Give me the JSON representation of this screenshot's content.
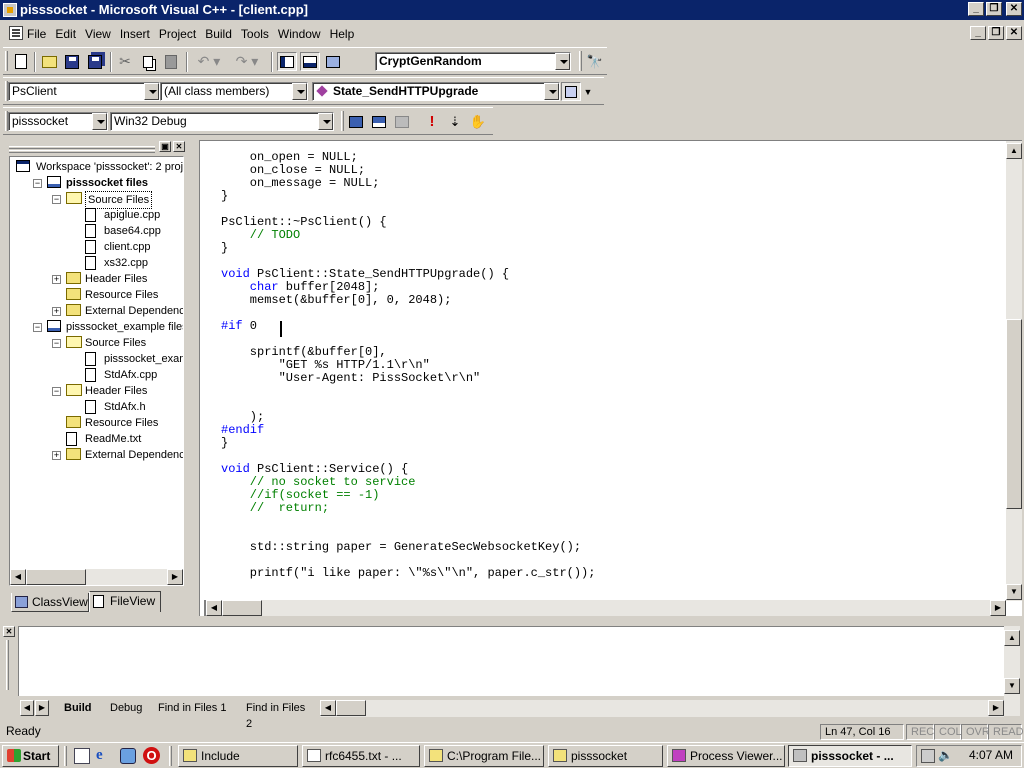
{
  "window": {
    "title": "pisssocket - Microsoft Visual C++ - [client.cpp]"
  },
  "menu": [
    "File",
    "Edit",
    "View",
    "Insert",
    "Project",
    "Build",
    "Tools",
    "Window",
    "Help"
  ],
  "toolbar": {
    "find_combo": "CryptGenRandom"
  },
  "wizardbar": {
    "class": "PsClient",
    "filter": "(All class members)",
    "member": "State_SendHTTPUpgrade"
  },
  "buildbar": {
    "project": "pisssocket",
    "config": "Win32 Debug"
  },
  "workspace": {
    "tree": [
      {
        "label": "Workspace 'pisssocket': 2 proje",
        "depth": 0,
        "icon": "workspace",
        "toggle": ""
      },
      {
        "label": "pisssocket files",
        "depth": 1,
        "icon": "project",
        "toggle": "−",
        "bold": true
      },
      {
        "label": "Source Files",
        "depth": 2,
        "icon": "folder-open",
        "toggle": "−",
        "selected": true
      },
      {
        "label": "apiglue.cpp",
        "depth": 3,
        "icon": "file-cpp",
        "toggle": ""
      },
      {
        "label": "base64.cpp",
        "depth": 3,
        "icon": "file-cpp",
        "toggle": ""
      },
      {
        "label": "client.cpp",
        "depth": 3,
        "icon": "file-cpp",
        "toggle": ""
      },
      {
        "label": "xs32.cpp",
        "depth": 3,
        "icon": "file-cpp",
        "toggle": ""
      },
      {
        "label": "Header Files",
        "depth": 2,
        "icon": "folder",
        "toggle": "+"
      },
      {
        "label": "Resource Files",
        "depth": 2,
        "icon": "folder",
        "toggle": ""
      },
      {
        "label": "External Dependencies",
        "depth": 2,
        "icon": "folder",
        "toggle": "+"
      },
      {
        "label": "pisssocket_example files",
        "depth": 1,
        "icon": "project",
        "toggle": "−"
      },
      {
        "label": "Source Files",
        "depth": 2,
        "icon": "folder-open",
        "toggle": "−"
      },
      {
        "label": "pisssocket_exampl",
        "depth": 3,
        "icon": "file-cpp",
        "toggle": ""
      },
      {
        "label": "StdAfx.cpp",
        "depth": 3,
        "icon": "file-cpp",
        "toggle": ""
      },
      {
        "label": "Header Files",
        "depth": 2,
        "icon": "folder-open",
        "toggle": "−"
      },
      {
        "label": "StdAfx.h",
        "depth": 3,
        "icon": "file-h",
        "toggle": ""
      },
      {
        "label": "Resource Files",
        "depth": 2,
        "icon": "folder",
        "toggle": ""
      },
      {
        "label": "ReadMe.txt",
        "depth": 2,
        "icon": "file-txt",
        "toggle": ""
      },
      {
        "label": "External Dependencies",
        "depth": 2,
        "icon": "folder",
        "toggle": "+"
      }
    ],
    "tabs": [
      "ClassView",
      "FileView"
    ]
  },
  "editor": {
    "lines": [
      [
        [
          "",
          "    on_open = NULL;"
        ]
      ],
      [
        [
          "",
          "    on_close = NULL;"
        ]
      ],
      [
        [
          "",
          "    on_message = NULL;"
        ]
      ],
      [
        [
          "",
          "}"
        ]
      ],
      [
        [
          "",
          ""
        ]
      ],
      [
        [
          "",
          "PsClient::~PsClient() {"
        ]
      ],
      [
        [
          "cm",
          "    // TODO"
        ]
      ],
      [
        [
          "",
          "}"
        ]
      ],
      [
        [
          "",
          ""
        ]
      ],
      [
        [
          "kw",
          "void"
        ],
        [
          "",
          " PsClient::State_SendHTTPUpgrade() {"
        ]
      ],
      [
        [
          "kw",
          "    char"
        ],
        [
          "",
          " buffer[2048];"
        ]
      ],
      [
        [
          "",
          "    memset(&buffer[0], 0, 2048);"
        ]
      ],
      [
        [
          "",
          ""
        ]
      ],
      [
        [
          "kw",
          "#if"
        ],
        [
          "",
          " 0"
        ]
      ],
      [
        [
          "",
          ""
        ]
      ],
      [
        [
          "",
          "    sprintf(&buffer[0],"
        ]
      ],
      [
        [
          "",
          "        \"GET %s HTTP/1.1\\r\\n\""
        ]
      ],
      [
        [
          "",
          "        \"User-Agent: PissSocket\\r\\n\""
        ]
      ],
      [
        [
          "",
          ""
        ]
      ],
      [
        [
          "",
          ""
        ]
      ],
      [
        [
          "",
          "    );"
        ]
      ],
      [
        [
          "kw",
          "#endif"
        ]
      ],
      [
        [
          "",
          "}"
        ]
      ],
      [
        [
          "",
          ""
        ]
      ],
      [
        [
          "kw",
          "void"
        ],
        [
          "",
          " PsClient::Service() {"
        ]
      ],
      [
        [
          "cm",
          "    // no socket to service"
        ]
      ],
      [
        [
          "cm",
          "    //if(socket == -1)"
        ]
      ],
      [
        [
          "cm",
          "    //  return;"
        ]
      ],
      [
        [
          "",
          ""
        ]
      ],
      [
        [
          "",
          ""
        ]
      ],
      [
        [
          "",
          "    std::string paper = GenerateSecWebsocketKey();"
        ]
      ],
      [
        [
          "",
          ""
        ]
      ],
      [
        [
          "",
          "    printf(\"i like paper: \\\"%s\\\"\\n\", paper.c_str());"
        ]
      ]
    ]
  },
  "output": {
    "tabs": [
      "Build",
      "Debug",
      "Find in Files 1",
      "Find in Files 2"
    ]
  },
  "status": {
    "text": "Ready",
    "position": "Ln 47, Col 16",
    "indicators": [
      "REC",
      "COL",
      "OVR",
      "READ"
    ]
  },
  "taskbar": {
    "start": "Start",
    "tasks": [
      "Include",
      "rfc6455.txt - ...",
      "C:\\Program File...",
      "pisssocket",
      "Process Viewer...",
      "pisssocket - ..."
    ],
    "clock": "4:07 AM"
  }
}
